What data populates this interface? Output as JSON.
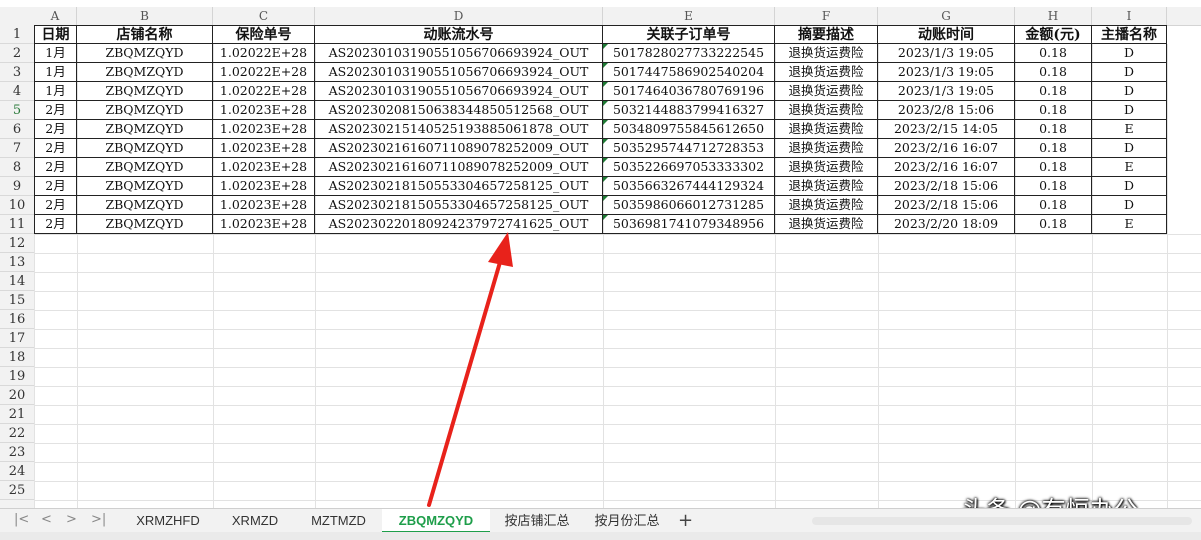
{
  "columns": [
    "A",
    "B",
    "C",
    "D",
    "E",
    "F",
    "G",
    "H",
    "I"
  ],
  "header": [
    "日期",
    "店铺名称",
    "保险单号",
    "动账流水号",
    "关联子订单号",
    "摘要描述",
    "动账时间",
    "金额(元)",
    "主播名称"
  ],
  "rows": [
    [
      "1月",
      "ZBQMZQYD",
      "1.02022E+28",
      "AS20230103190551056706693924_OUT",
      "5017828027733222545",
      "退换货运费险",
      "2023/1/3 19:05",
      "0.18",
      "D"
    ],
    [
      "1月",
      "ZBQMZQYD",
      "1.02022E+28",
      "AS20230103190551056706693924_OUT",
      "5017447586902540204",
      "退换货运费险",
      "2023/1/3 19:05",
      "0.18",
      "D"
    ],
    [
      "1月",
      "ZBQMZQYD",
      "1.02022E+28",
      "AS20230103190551056706693924_OUT",
      "5017464036780769196",
      "退换货运费险",
      "2023/1/3 19:05",
      "0.18",
      "D"
    ],
    [
      "2月",
      "ZBQMZQYD",
      "1.02023E+28",
      "AS20230208150638344850512568_OUT",
      "5032144883799416327",
      "退换货运费险",
      "2023/2/8 15:06",
      "0.18",
      "D"
    ],
    [
      "2月",
      "ZBQMZQYD",
      "1.02023E+28",
      "AS20230215140525193885061878_OUT",
      "5034809755845612650",
      "退换货运费险",
      "2023/2/15 14:05",
      "0.18",
      "E"
    ],
    [
      "2月",
      "ZBQMZQYD",
      "1.02023E+28",
      "AS20230216160711089078252009_OUT",
      "5035295744712728353",
      "退换货运费险",
      "2023/2/16 16:07",
      "0.18",
      "D"
    ],
    [
      "2月",
      "ZBQMZQYD",
      "1.02023E+28",
      "AS20230216160711089078252009_OUT",
      "5035226697053333302",
      "退换货运费险",
      "2023/2/16 16:07",
      "0.18",
      "E"
    ],
    [
      "2月",
      "ZBQMZQYD",
      "1.02023E+28",
      "AS20230218150553304657258125_OUT",
      "5035663267444129324",
      "退换货运费险",
      "2023/2/18 15:06",
      "0.18",
      "D"
    ],
    [
      "2月",
      "ZBQMZQYD",
      "1.02023E+28",
      "AS20230218150553304657258125_OUT",
      "5035986066012731285",
      "退换货运费险",
      "2023/2/18 15:06",
      "0.18",
      "D"
    ],
    [
      "2月",
      "ZBQMZQYD",
      "1.02023E+28",
      "AS20230220180924237972741625_OUT",
      "5036981741079348956",
      "退换货运费险",
      "2023/2/20 18:09",
      "0.18",
      "E"
    ]
  ],
  "row_numbers": [
    "1",
    "2",
    "3",
    "4",
    "5",
    "6",
    "7",
    "8",
    "9",
    "10",
    "11",
    "12",
    "13",
    "14",
    "15",
    "16",
    "17",
    "18",
    "19",
    "20",
    "21",
    "22",
    "23",
    "24",
    "25"
  ],
  "selected_row": "5",
  "tabs": [
    {
      "label": "XRMZHFD",
      "active": false
    },
    {
      "label": "XRMZD",
      "active": false
    },
    {
      "label": "MZTMZD",
      "active": false
    },
    {
      "label": "ZBQMZQYD",
      "active": true
    },
    {
      "label": "按店铺汇总",
      "active": false
    },
    {
      "label": "按月份汇总",
      "active": false
    }
  ],
  "nav_icons": [
    "first-sheet-icon",
    "prev-sheet-icon",
    "next-sheet-icon",
    "last-sheet-icon"
  ],
  "nav_glyphs": [
    "|<",
    "<",
    ">",
    ">|"
  ],
  "add_tab_glyph": "+",
  "watermark": "头条 @有恒办公",
  "colors": {
    "accent": "#1e9e4a",
    "arrow": "#e8221b",
    "grid": "#e2e2e2",
    "header_bg": "#f2f2f2"
  }
}
